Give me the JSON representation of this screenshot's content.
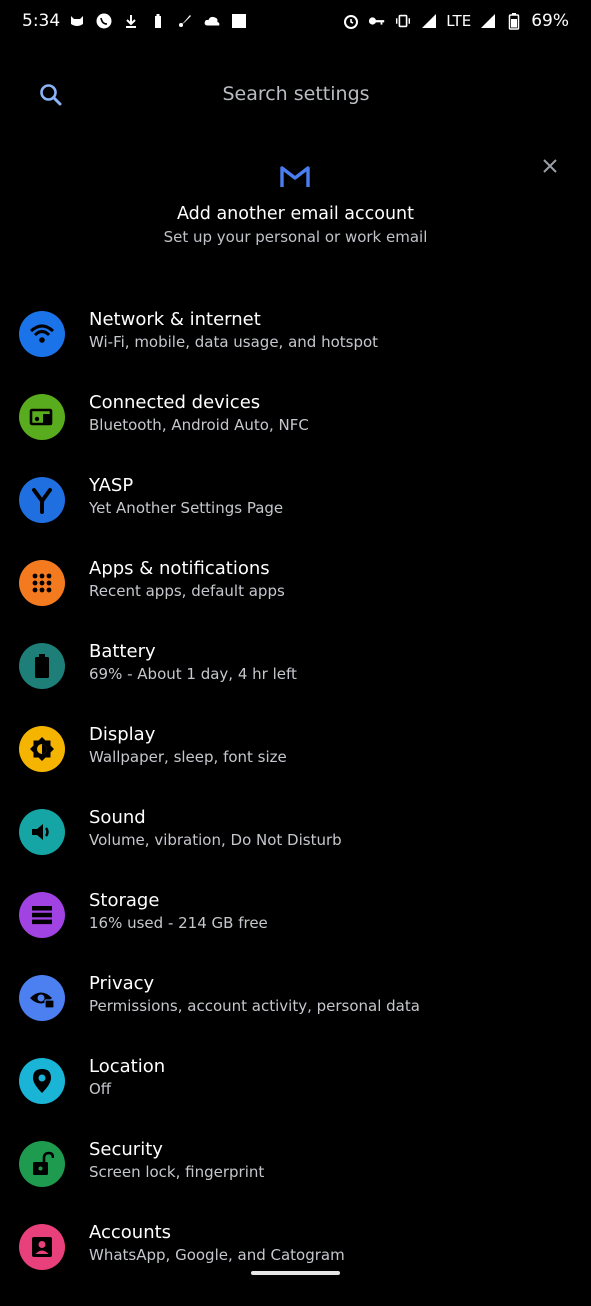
{
  "status_bar": {
    "time": "5:34",
    "network": "LTE",
    "battery": "69%",
    "left_icons": [
      "cat-icon",
      "whatsapp-icon",
      "download-icon",
      "battery-small-icon",
      "rocket-icon",
      "cloud-icon",
      "square-icon"
    ],
    "right_icons": [
      "alarm-icon",
      "key-icon",
      "vibrate-icon",
      "signal-icon",
      "battery-icon"
    ]
  },
  "search": {
    "placeholder": "Search settings"
  },
  "suggestion": {
    "title": "Add another email account",
    "subtitle": "Set up your personal or work email",
    "icon": "gmail-icon",
    "accent": "#4a7df0"
  },
  "items": [
    {
      "title": "Network & internet",
      "subtitle": "Wi-Fi, mobile, data usage, and hotspot",
      "icon": "wifi-icon",
      "color": "#1a73e8"
    },
    {
      "title": "Connected devices",
      "subtitle": "Bluetooth, Android Auto, NFC",
      "icon": "devices-icon",
      "color": "#5aac1f"
    },
    {
      "title": "YASP",
      "subtitle": "Yet Another Settings Page",
      "icon": "yasp-icon",
      "color": "#1f6fe0"
    },
    {
      "title": "Apps & notifications",
      "subtitle": "Recent apps, default apps",
      "icon": "apps-icon",
      "color": "#f47a20"
    },
    {
      "title": "Battery",
      "subtitle": "69% - About 1 day, 4 hr left",
      "icon": "battery-icon",
      "color": "#1d7f78"
    },
    {
      "title": "Display",
      "subtitle": "Wallpaper, sleep, font size",
      "icon": "display-icon",
      "color": "#f4b400"
    },
    {
      "title": "Sound",
      "subtitle": "Volume, vibration, Do Not Disturb",
      "icon": "sound-icon",
      "color": "#15a5a5"
    },
    {
      "title": "Storage",
      "subtitle": "16% used - 214 GB free",
      "icon": "storage-icon",
      "color": "#a142e2"
    },
    {
      "title": "Privacy",
      "subtitle": "Permissions, account activity, personal data",
      "icon": "privacy-icon",
      "color": "#4c7ff0"
    },
    {
      "title": "Location",
      "subtitle": "Off",
      "icon": "location-icon",
      "color": "#1ab5d6"
    },
    {
      "title": "Security",
      "subtitle": "Screen lock, fingerprint",
      "icon": "security-icon",
      "color": "#1e9b4e"
    },
    {
      "title": "Accounts",
      "subtitle": "WhatsApp, Google, and Catogram",
      "icon": "accounts-icon",
      "color": "#e8407a"
    }
  ]
}
